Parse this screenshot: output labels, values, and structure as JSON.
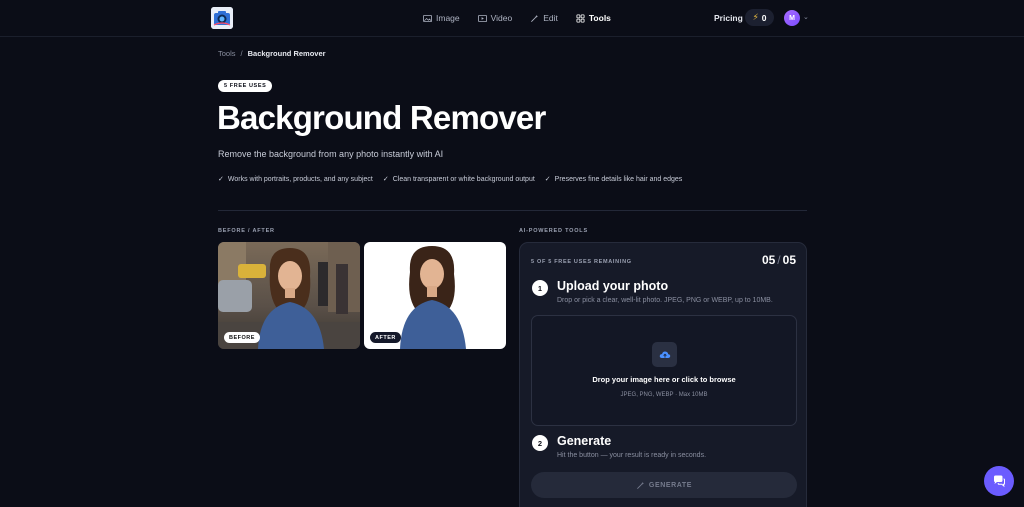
{
  "nav": {
    "links": [
      {
        "label": "Image",
        "icon": "image-icon"
      },
      {
        "label": "Video",
        "icon": "video-icon"
      },
      {
        "label": "Edit",
        "icon": "wand-icon"
      },
      {
        "label": "Tools",
        "icon": "grid-icon"
      }
    ],
    "pricing": "Pricing",
    "credits": "0",
    "avatar_initial": "M"
  },
  "breadcrumb": {
    "root": "Tools",
    "separator": "/",
    "current": "Background Remover"
  },
  "hero": {
    "badge": "5 FREE USES",
    "title": "Background Remover",
    "subtitle": "Remove the background from any photo instantly with AI",
    "features": [
      "Works with portraits, products, and any subject",
      "Clean transparent or white background output",
      "Preserves fine details like hair and edges"
    ]
  },
  "before_after": {
    "label": "BEFORE / AFTER",
    "before_tag": "BEFORE",
    "after_tag": "AFTER"
  },
  "tools": {
    "label": "AI-POWERED TOOLS",
    "uses_remaining": "5 OF 5 FREE USES REMAINING",
    "counter_current": "05",
    "counter_sep": "/",
    "counter_total": "05",
    "step1": {
      "num": "1",
      "title": "Upload your photo",
      "desc": "Drop or pick a clear, well-lit photo. JPEG, PNG or WEBP, up to 10MB."
    },
    "dropzone": {
      "main": "Drop your image here or click to browse",
      "sub": "JPEG, PNG, WEBP · Max 10MB"
    },
    "step2": {
      "num": "2",
      "title": "Generate",
      "desc": "Hit the button — your result is ready in seconds."
    },
    "generate_label": "GENERATE"
  },
  "colors": {
    "background": "#0b0d17",
    "panel": "#161a28",
    "accent": "#6b5cff",
    "upload_icon": "#4a90ff"
  }
}
